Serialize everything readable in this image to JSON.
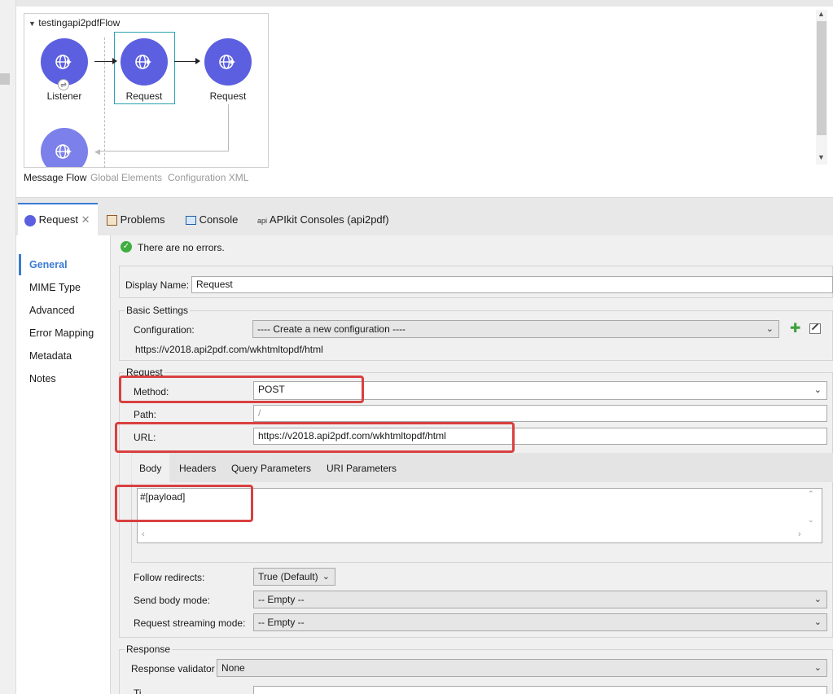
{
  "flow": {
    "title": "testingapi2pdfFlow",
    "nodes": [
      {
        "label": "Listener",
        "icon": "globe-arrow-icon"
      },
      {
        "label": "Request",
        "icon": "globe-arrow-icon"
      },
      {
        "label": "Request",
        "icon": "globe-arrow-icon"
      }
    ],
    "tabs": [
      "Message Flow",
      "Global Elements",
      "Configuration XML"
    ],
    "accent": "#5b5fe0"
  },
  "panel_tabs": [
    {
      "label": "Request",
      "icon": "request-icon"
    },
    {
      "label": "Problems",
      "icon": "problems-icon"
    },
    {
      "label": "Console",
      "icon": "console-icon"
    },
    {
      "label": "APIkit Consoles (api2pdf)",
      "icon": "api-icon",
      "prefix": "api"
    }
  ],
  "status": "There are no errors.",
  "nav": [
    "General",
    "MIME Type",
    "Advanced",
    "Error Mapping",
    "Metadata",
    "Notes"
  ],
  "form": {
    "display_name_label": "Display Name:",
    "display_name_value": "Request",
    "basic_settings_title": "Basic Settings",
    "configuration_label": "Configuration:",
    "configuration_value": "---- Create a new configuration ----",
    "configuration_url": "https://v2018.api2pdf.com/wkhtmltopdf/html",
    "request_title": "Request",
    "method_label": "Method:",
    "method_value": "POST",
    "path_label": "Path:",
    "path_placeholder": "/",
    "url_label": "URL:",
    "url_value": "https://v2018.api2pdf.com/wkhtmltopdf/html",
    "body_tabs": [
      "Body",
      "Headers",
      "Query Parameters",
      "URI Parameters"
    ],
    "body_value": "#[payload]",
    "follow_redirects_label": "Follow redirects:",
    "follow_redirects_value": "True (Default)",
    "send_body_mode_label": "Send body mode:",
    "send_body_mode_value": "-- Empty --",
    "request_streaming_label": "Request streaming mode:",
    "request_streaming_value": "-- Empty --",
    "response_title": "Response",
    "response_validator_label": "Response validator",
    "response_validator_value": "None",
    "timeout_label_partial": "Ti"
  }
}
